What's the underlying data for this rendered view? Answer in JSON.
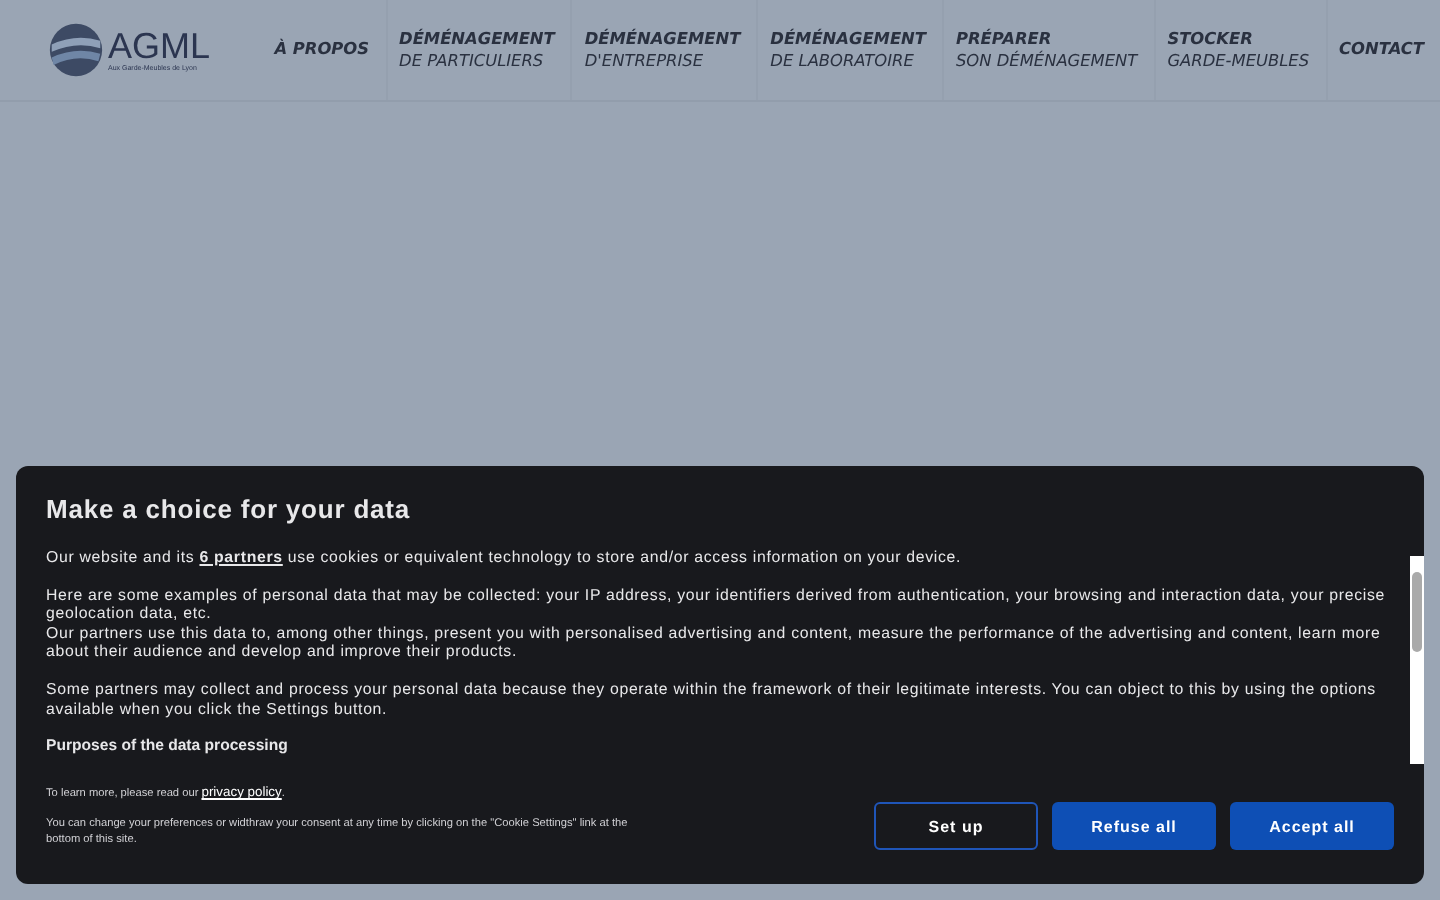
{
  "header": {
    "logo": {
      "name": "AGML",
      "tagline": "Aux Garde-Meubles de Lyon"
    },
    "nav": [
      {
        "title": "À PROPOS"
      },
      {
        "title": "DÉMÉNAGEMENT",
        "subtitle": "DE PARTICULIERS"
      },
      {
        "title": "DÉMÉNAGEMENT",
        "subtitle": "D'ENTREPRISE"
      },
      {
        "title": "DÉMÉNAGEMENT",
        "subtitle": "DE LABORATOIRE"
      },
      {
        "title": "PRÉPARER",
        "subtitle": "SON DÉMÉNAGEMENT"
      },
      {
        "title": "STOCKER",
        "subtitle": "GARDE-MEUBLES"
      },
      {
        "title": "CONTACT"
      }
    ]
  },
  "consent": {
    "title": "Make a choice for your data",
    "paragraphs": [
      [
        "Our website and its ",
        "6 partners",
        " use cookies or equivalent technology to store and/or access information on your device."
      ],
      [
        "Here are some examples of personal data that may be collected: your IP address, your identifiers derived from authentication, your browsing and interaction data, your precise geolocation data, etc.",
        "Our partners use this data to, among other things, present you with personalised advertising and content, measure the performance of the advertising and content, learn more about their audience and develop and improve their products."
      ],
      [
        "Some partners may collect and process your personal data because they operate within the framework of their legitimate interests. You can object to this by using the options available when you click the Settings button."
      ]
    ],
    "purposes_heading": "Purposes of the data processing",
    "learn_more": [
      "To learn more, please read our ",
      "privacy policy",
      "."
    ],
    "change_note": "You can change your preferences or widthraw your consent at any time by clicking on the \"Cookie Settings\" link at the bottom of this site.",
    "buttons": [
      {
        "label": "Set up",
        "kind": "outline"
      },
      {
        "label": "Refuse all",
        "kind": "filled"
      },
      {
        "label": "Accept all",
        "kind": "filled"
      }
    ]
  }
}
